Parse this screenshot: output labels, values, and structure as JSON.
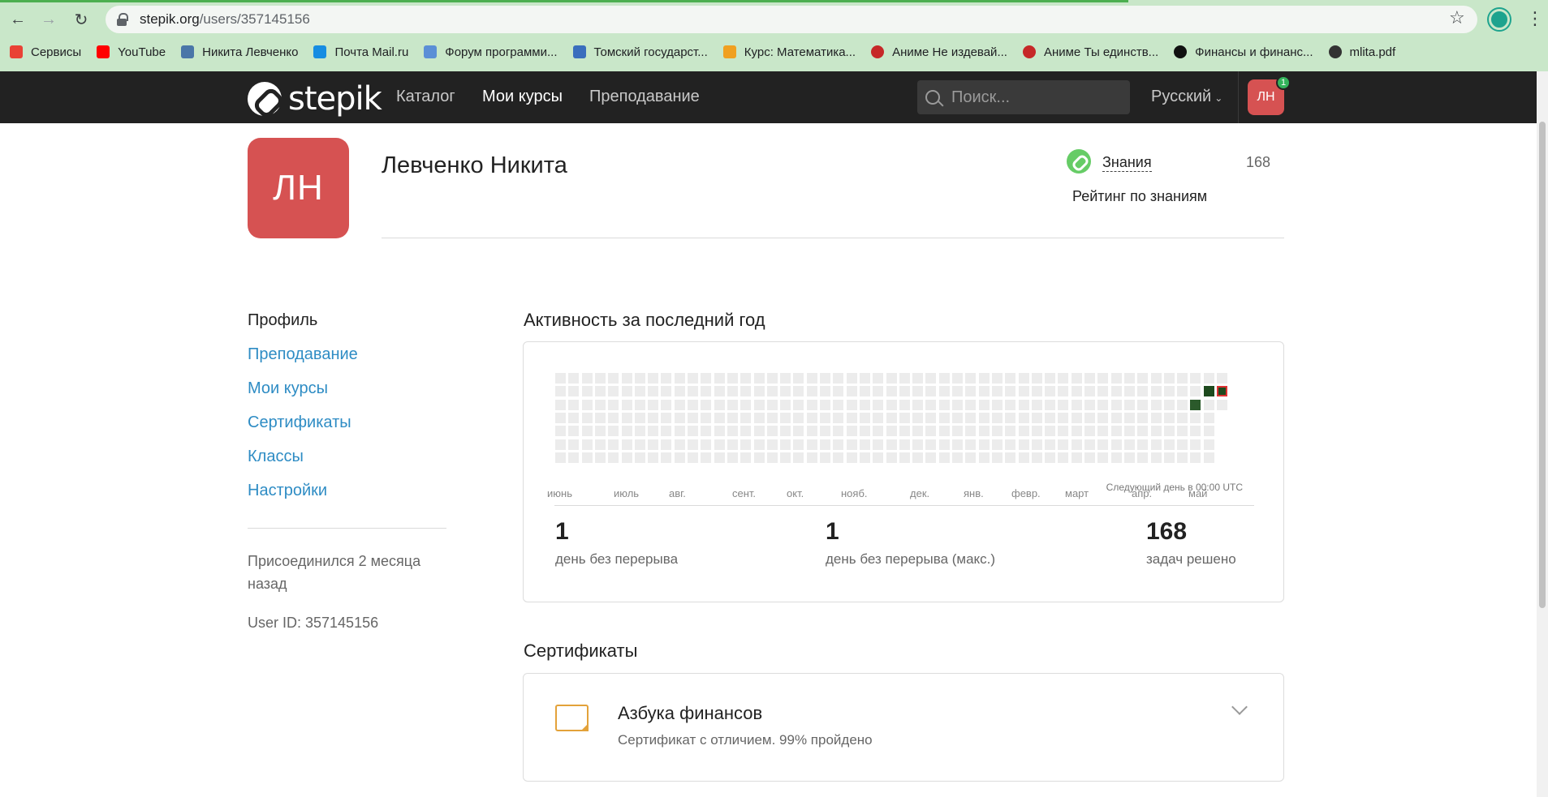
{
  "browser": {
    "url_host": "stepik.org",
    "url_path": "/users/357145156",
    "bookmarks": [
      {
        "label": "Сервисы",
        "icon": "apps-grid-icon",
        "color": "#e94235"
      },
      {
        "label": "YouTube",
        "icon": "youtube-icon",
        "color": "#ff0000"
      },
      {
        "label": "Никита Левченко",
        "icon": "vk-icon",
        "color": "#4a76a8"
      },
      {
        "label": "Почта Mail.ru",
        "icon": "mail-icon",
        "color": "#168de2"
      },
      {
        "label": "Форум программи...",
        "icon": "forum-icon",
        "color": "#5b8fd6"
      },
      {
        "label": "Томский государст...",
        "icon": "university-icon",
        "color": "#3a6ebd"
      },
      {
        "label": "Курс: Математика...",
        "icon": "course-icon",
        "color": "#f0a020"
      },
      {
        "label": "Аниме Не издевай...",
        "icon": "anime-icon",
        "color": "#c62828"
      },
      {
        "label": "Аниме Ты единств...",
        "icon": "anime-icon",
        "color": "#c62828"
      },
      {
        "label": "Финансы и финанс...",
        "icon": "stepik-icon",
        "color": "#111111"
      },
      {
        "label": "mlita.pdf",
        "icon": "globe-icon",
        "color": "#333333"
      }
    ]
  },
  "header": {
    "logo_text": "stepik",
    "nav": [
      "Каталог",
      "Мои курсы",
      "Преподавание"
    ],
    "active_nav": "Мои курсы",
    "search_placeholder": "Поиск...",
    "language": "Русский",
    "avatar_initials": "ЛН",
    "notification_count": "1"
  },
  "profile": {
    "initials": "ЛН",
    "name": "Левченко Никита",
    "knowledge_label": "Знания",
    "knowledge_value": "168",
    "rating_link": "Рейтинг по знаниям"
  },
  "sidebar": {
    "items": [
      "Профиль",
      "Преподавание",
      "Мои курсы",
      "Сертификаты",
      "Классы",
      "Настройки"
    ],
    "active": "Профиль",
    "joined": "Присоединился 2 месяца назад",
    "user_id": "User ID: 357145156"
  },
  "activity": {
    "title": "Активность за последний год",
    "months": [
      "июнь",
      "июль",
      "авг.",
      "сент.",
      "окт.",
      "нояб.",
      "дек.",
      "янв.",
      "февр.",
      "март",
      "апр.",
      "май"
    ],
    "active_days": [
      {
        "week": 48,
        "day": 2,
        "level": 1
      },
      {
        "week": 49,
        "day": 1,
        "level": 2
      },
      {
        "week": 50,
        "day": 1,
        "level": 2,
        "today": true
      }
    ],
    "next_day_note": "Следующий день в 00:00 UTC",
    "stats": [
      {
        "value": "1",
        "caption": "день без перерыва"
      },
      {
        "value": "1",
        "caption": "день без перерыва (макс.)"
      },
      {
        "value": "168",
        "caption": "задач решено"
      }
    ]
  },
  "certificates": {
    "title": "Сертификаты",
    "items": [
      {
        "name": "Азбука финансов",
        "subtitle": "Сертификат с отличием. 99% пройдено"
      }
    ]
  }
}
